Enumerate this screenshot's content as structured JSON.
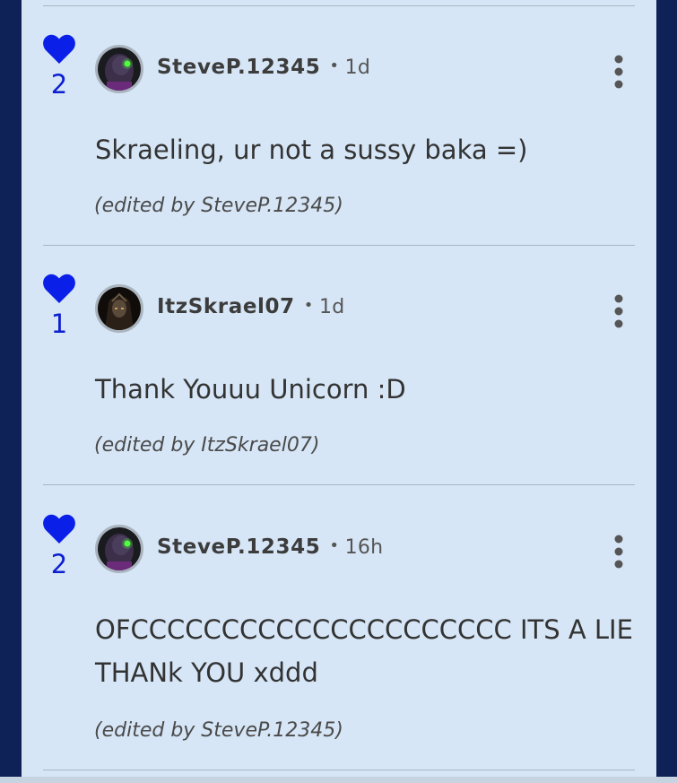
{
  "comments": [
    {
      "likes": "2",
      "author": "SteveP.12345",
      "time": "1d",
      "text": "Skraeling, ur not a sussy baka =)",
      "edited": "(edited by SteveP.12345)",
      "avatar": "robot-avatar"
    },
    {
      "likes": "1",
      "author": "ItzSkrael07",
      "time": "1d",
      "text": "Thank Youuu Unicorn  :D",
      "edited": "(edited by ItzSkrael07)",
      "avatar": "hooded-avatar"
    },
    {
      "likes": "2",
      "author": "SteveP.12345",
      "time": "16h",
      "text": "OFCCCCCCCCCCCCCCCCCCCCC ITS A LIE THANk YOU xddd",
      "edited": "(edited by SteveP.12345)",
      "avatar": "robot-avatar"
    }
  ],
  "colors": {
    "like_heart": "#0a1fe8",
    "page_background": "#0f2257",
    "panel_background": "#d6e6f6"
  },
  "icons": {
    "like": "heart-icon",
    "menu": "kebab-menu-icon"
  }
}
